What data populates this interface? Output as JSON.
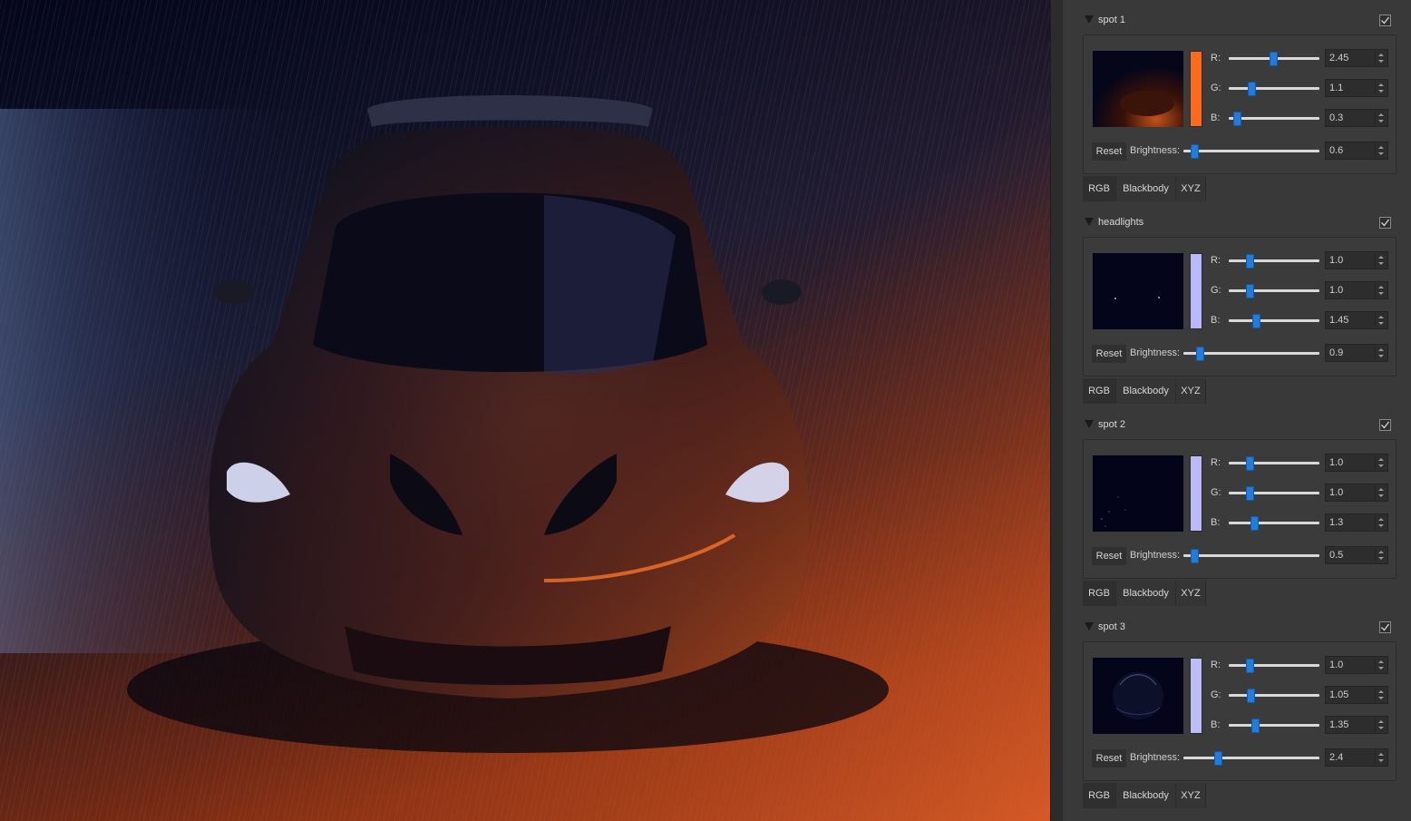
{
  "viewport": {
    "subject": "render-view"
  },
  "tabs": [
    "RGB",
    "Blackbody",
    "XYZ"
  ],
  "reset_label": "Reset",
  "brightness_label": "Brightness:",
  "channel_labels": [
    "R:",
    "G:",
    "B:"
  ],
  "lights": [
    {
      "name": "spot 1",
      "enabled": true,
      "color": "#ff6a1a",
      "r": "2.45",
      "g": "1.1",
      "b": "0.3",
      "brightness": "0.6",
      "r_level": 0.49,
      "g_level": 0.25,
      "b_level": 0.09,
      "brightness_level": 0.08
    },
    {
      "name": "headlights",
      "enabled": true,
      "color": "#b8b8ff",
      "r": "1.0",
      "g": "1.0",
      "b": "1.45",
      "brightness": "0.9",
      "r_level": 0.23,
      "g_level": 0.23,
      "b_level": 0.3,
      "brightness_level": 0.12
    },
    {
      "name": "spot 2",
      "enabled": true,
      "color": "#babaf8",
      "r": "1.0",
      "g": "1.0",
      "b": "1.3",
      "brightness": "0.5",
      "r_level": 0.23,
      "g_level": 0.23,
      "b_level": 0.28,
      "brightness_level": 0.08
    },
    {
      "name": "spot 3",
      "enabled": true,
      "color": "#bdbdf6",
      "r": "1.0",
      "g": "1.05",
      "b": "1.35",
      "brightness": "2.4",
      "r_level": 0.23,
      "g_level": 0.24,
      "b_level": 0.29,
      "brightness_level": 0.25
    }
  ],
  "active_tab": "RGB"
}
